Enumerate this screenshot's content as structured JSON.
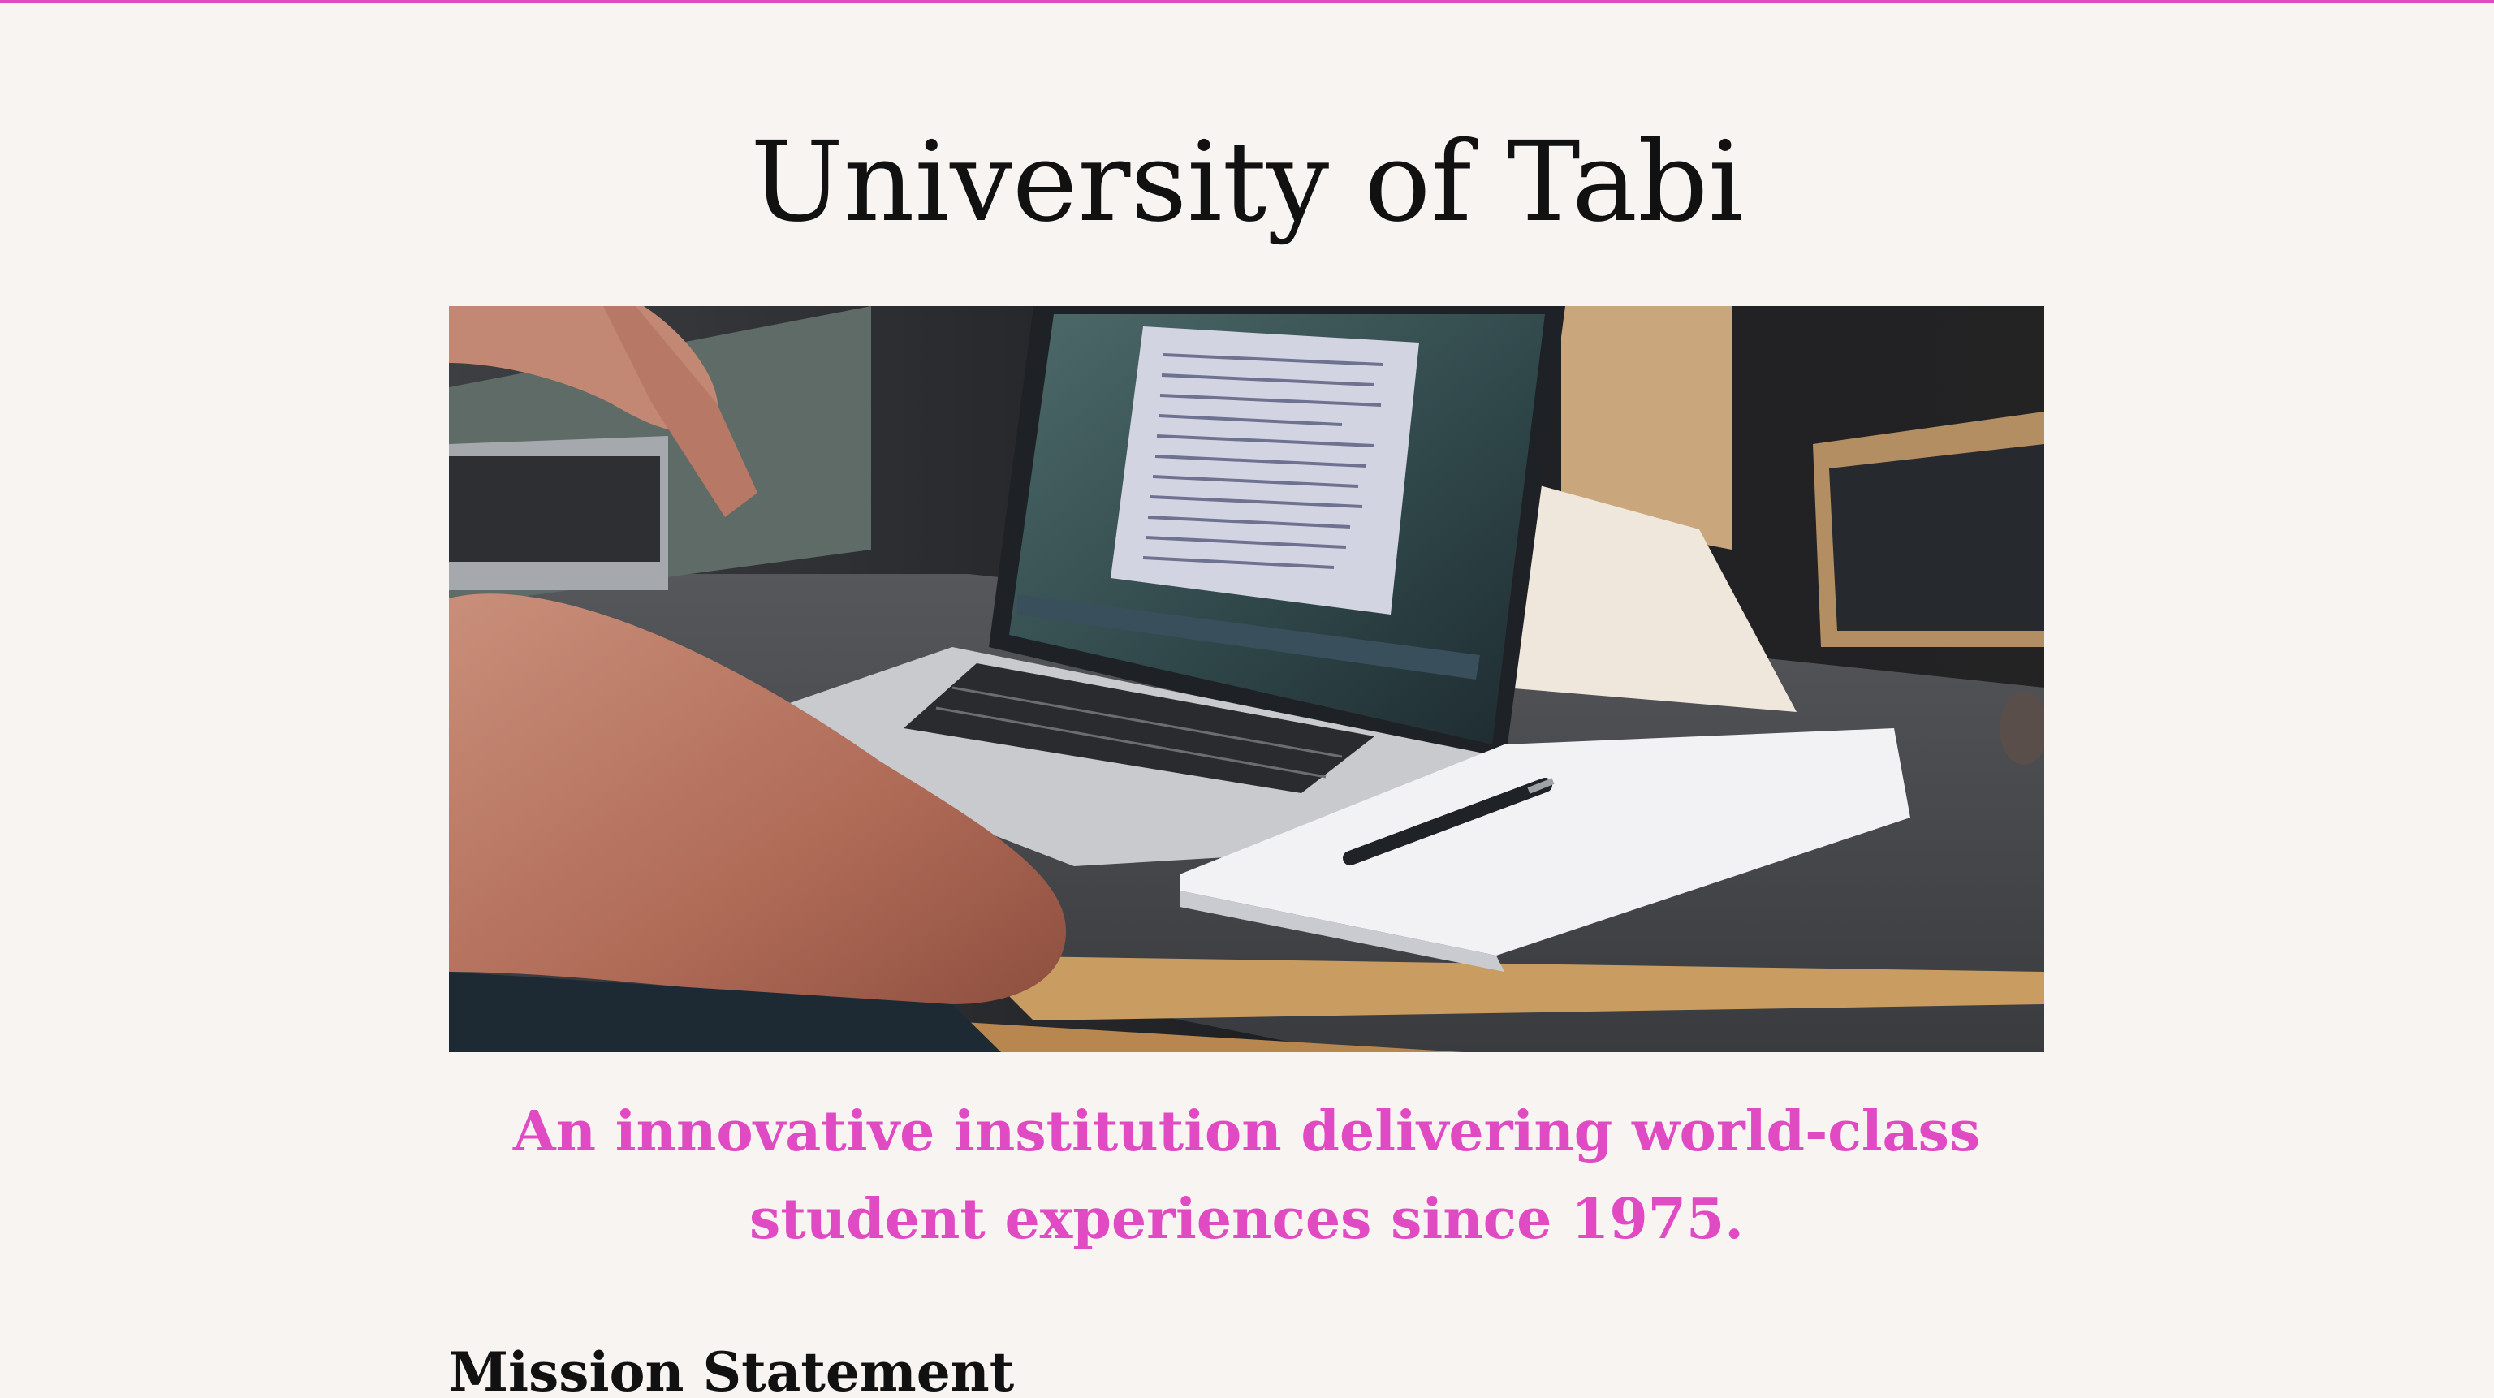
{
  "page": {
    "title": "University of Tabi",
    "tagline": "An innovative institution delivering world-class student experiences since 1975.",
    "accent_color": "#e04bc3",
    "background_color": "#f8f4f2"
  },
  "hero": {
    "alt": "Student working on a laptop in a classroom"
  },
  "sections": {
    "mission_heading": "Mission Statement"
  }
}
